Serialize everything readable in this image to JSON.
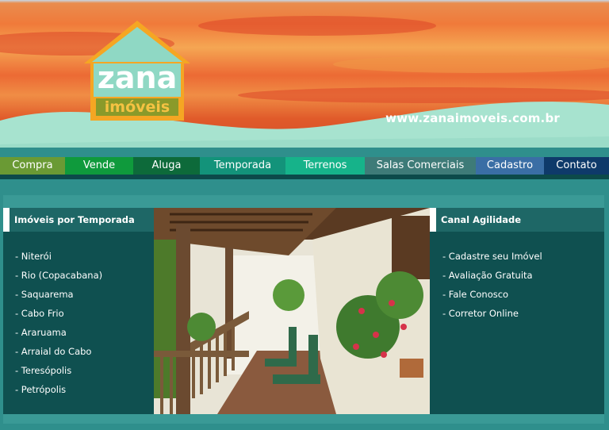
{
  "header": {
    "logo_word": "zana",
    "logo_sub": "imóveis",
    "site_url": "www.zanaimoveis.com.br"
  },
  "nav": {
    "items": [
      {
        "label": "Compra",
        "color": "#6a9a34"
      },
      {
        "label": "Vende",
        "color": "#0f9a3c"
      },
      {
        "label": "Aluga",
        "color": "#0d6a3a"
      },
      {
        "label": "Temporada",
        "color": "#13937a"
      },
      {
        "label": "Terrenos",
        "color": "#16b38a"
      },
      {
        "label": "Salas Comerciais",
        "color": "#3e7b78"
      },
      {
        "label": "Cadastro",
        "color": "#3a6ea5"
      },
      {
        "label": "Contato",
        "color": "#0e3a6a"
      }
    ]
  },
  "left_panel": {
    "title": "Imóveis por Temporada",
    "links": [
      "- Niterói",
      "- Rio (Copacabana)",
      "- Saquarema",
      "- Cabo Frio",
      "- Araruama",
      "- Arraial do Cabo",
      "- Teresópolis",
      "- Petrópolis"
    ]
  },
  "right_panel": {
    "title": "Canal Agilidade",
    "links": [
      "- Cadastre seu Imóvel",
      "- Avaliação Gratuita",
      "- Fale Conosco",
      "- Corretor Online"
    ]
  }
}
